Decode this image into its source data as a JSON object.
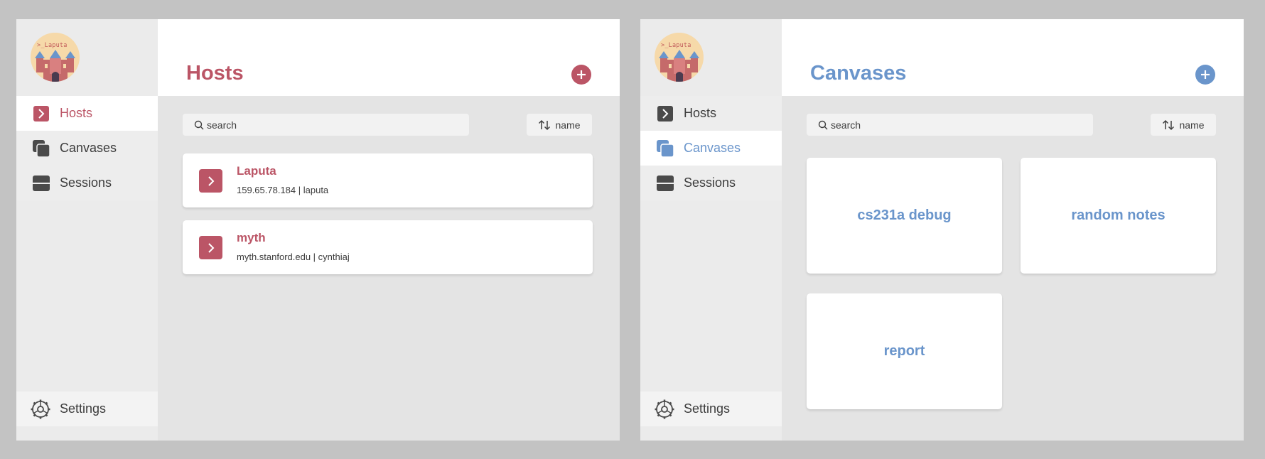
{
  "logo": {
    "text": ">_Laputa"
  },
  "colors": {
    "hosts_accent": "#bb5566",
    "canvases_accent": "#6a95cb",
    "window_bg": "#e4e4e4",
    "sidebar_bg": "#ebebeb"
  },
  "hosts_window": {
    "nav": [
      {
        "label": "Hosts",
        "icon": "terminal-icon",
        "active": true
      },
      {
        "label": "Canvases",
        "icon": "stacked-squares-icon",
        "active": false
      },
      {
        "label": "Sessions",
        "icon": "sessions-icon",
        "active": false
      }
    ],
    "settings_label": "Settings",
    "title": "Hosts",
    "search_placeholder": "search",
    "sort_label": "name",
    "hosts": [
      {
        "name": "Laputa",
        "detail": "159.65.78.184 | laputa"
      },
      {
        "name": "myth",
        "detail": "myth.stanford.edu | cynthiaj"
      }
    ]
  },
  "canvases_window": {
    "nav": [
      {
        "label": "Hosts",
        "icon": "terminal-icon",
        "active": false
      },
      {
        "label": "Canvases",
        "icon": "stacked-squares-icon",
        "active": true
      },
      {
        "label": "Sessions",
        "icon": "sessions-icon",
        "active": false
      }
    ],
    "settings_label": "Settings",
    "title": "Canvases",
    "search_placeholder": "search",
    "sort_label": "name",
    "canvases": [
      {
        "title": "cs231a debug"
      },
      {
        "title": "random notes"
      },
      {
        "title": "report"
      }
    ]
  }
}
